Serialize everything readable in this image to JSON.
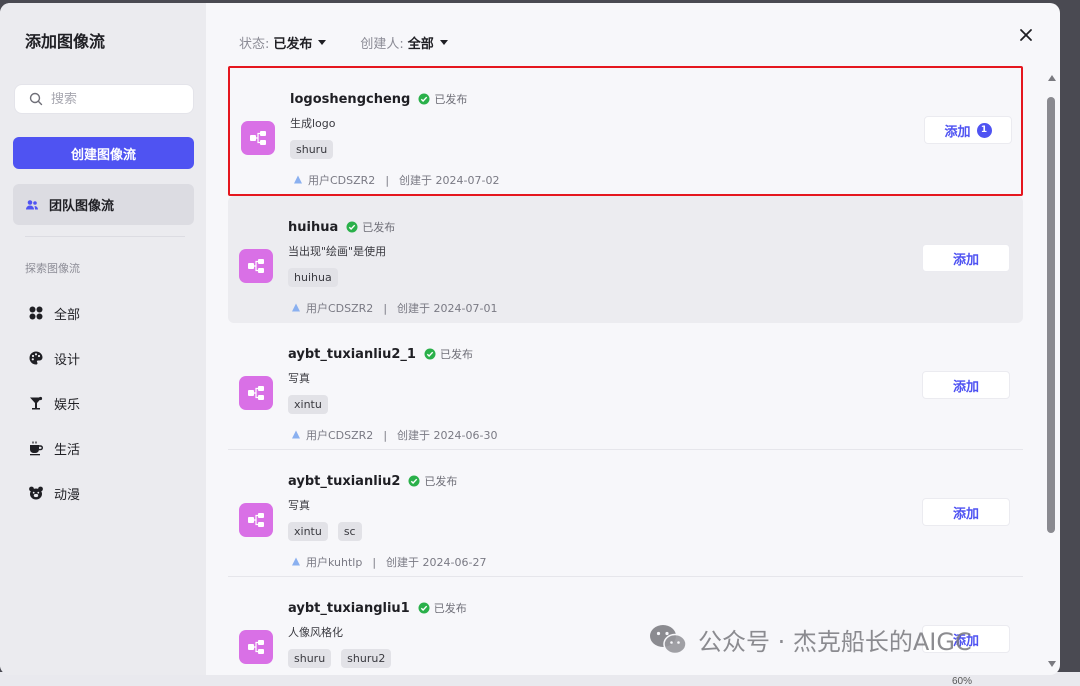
{
  "sidebar": {
    "title": "添加图像流",
    "search_placeholder": "搜索",
    "create_button": "创建图像流",
    "team_item": "团队图像流",
    "section_label": "探索图像流",
    "categories": [
      {
        "label": "全部",
        "icon": "grid-icon"
      },
      {
        "label": "设计",
        "icon": "palette-icon"
      },
      {
        "label": "娱乐",
        "icon": "cocktail-icon"
      },
      {
        "label": "生活",
        "icon": "cup-icon"
      },
      {
        "label": "动漫",
        "icon": "bear-icon"
      }
    ]
  },
  "filters": {
    "status_label": "状态:",
    "status_value": "已发布",
    "creator_label": "创建人:",
    "creator_value": "全部"
  },
  "workflows": [
    {
      "name": "logoshengcheng",
      "status": "已发布",
      "desc": "生成logo",
      "tags": [
        "shuru"
      ],
      "user": "用户CDSZR2",
      "created": "创建于 2024-07-02",
      "button": "添加",
      "badge": "1"
    },
    {
      "name": "huihua",
      "status": "已发布",
      "desc": "当出现\"绘画\"是使用",
      "tags": [
        "huihua"
      ],
      "user": "用户CDSZR2",
      "created": "创建于 2024-07-01",
      "button": "添加"
    },
    {
      "name": "aybt_tuxianliu2_1",
      "status": "已发布",
      "desc": "写真",
      "tags": [
        "xintu"
      ],
      "user": "用户CDSZR2",
      "created": "创建于 2024-06-30",
      "button": "添加"
    },
    {
      "name": "aybt_tuxianliu2",
      "status": "已发布",
      "desc": "写真",
      "tags": [
        "xintu",
        "sc"
      ],
      "user": "用户kuhtlp",
      "created": "创建于 2024-06-27",
      "button": "添加"
    },
    {
      "name": "aybt_tuxiangliu1",
      "status": "已发布",
      "desc": "人像风格化",
      "tags": [
        "shuru",
        "shuru2"
      ],
      "user": "",
      "created": "",
      "button": "添加"
    }
  ],
  "watermark": "公众号 · 杰克船长的AIGC",
  "background_zoom": "60%",
  "colors": {
    "accent": "#4f53f2",
    "icon_bg": "#d970e6",
    "selected_border": "#e5161e",
    "published_check": "#2ab04a"
  }
}
